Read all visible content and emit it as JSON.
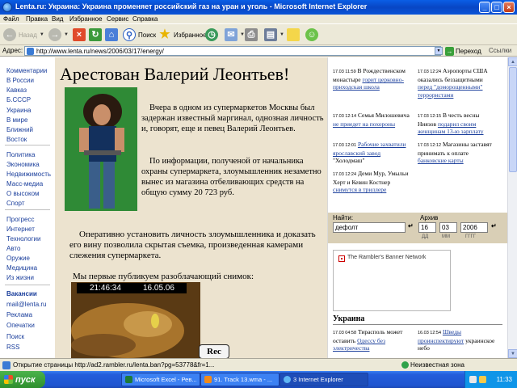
{
  "window": {
    "title": "Lenta.ru: Украина: Украина променяет российский газ на уран и уголь - Microsoft Internet Explorer",
    "min": "_",
    "max": "□",
    "close": "×"
  },
  "menu": [
    "Файл",
    "Правка",
    "Вид",
    "Избранное",
    "Сервис",
    "Справка"
  ],
  "toolbar": {
    "back": "Назад",
    "search": "Поиск",
    "favorites": "Избранное"
  },
  "addressbar": {
    "label": "Адрес:",
    "url": "http://www.lenta.ru/news/2006/03/17/energy/",
    "go": "Переход",
    "links": "Ссылки"
  },
  "leftnav": [
    "Комментарии",
    "В России",
    "Кавказ",
    "Б.СССР",
    "Украина",
    "В мире",
    "Ближний",
    "Восток",
    "Политика",
    "Экономика",
    "Недвижимость",
    "Масс-медиа",
    "О высоком",
    "Спорт",
    "Прогресс",
    "Интернет",
    "Технологии",
    "Авто",
    "Оружие",
    "Медицина",
    "Из жизни",
    "Вакансии",
    "mail@lenta.ru",
    "Реклама",
    "Опечатки",
    "Поиск",
    "RSS"
  ],
  "article": {
    "title": "Арестован Валерий Леонтьев!",
    "p1": "Вчера в одном из супермаркетов Москвы был задержан известный маргинал, однозная личность и, говорят, еще и певец Валерий Леонтьев.",
    "p2": "По информации, полученой от начальника охраны супермаркета, злоумышленник незаметно вынес из магазина отбеливающих средств на общую сумму 20 723 руб.",
    "p3": "Оперативно установить личность злоумышленника и доказать его вину позволила скрытая съемка, произведенная камерами слежения супермаркета.",
    "p4": "Мы первые публикуем разоблачающий снимок:",
    "cam_time": "21:46:34",
    "cam_date": "16.05.06",
    "rec": "Rec"
  },
  "sidebar": {
    "news_left": [
      {
        "time": "17.03 11:59",
        "pre": "В Рождественском монастыре",
        "link": "горит церковно-приходская школа",
        "post": ""
      },
      {
        "time": "17.03 12:14",
        "pre": "Семья Милошевича",
        "link": "не приедет на похороны",
        "post": ""
      },
      {
        "time": "17.03 12:01",
        "pre": "",
        "link": "Рабочие захватили ярославский завод",
        "post": "\"Холодмаш\""
      },
      {
        "time": "17.03 12:24",
        "pre": "Деми Мур, Умыльи Херт и Кевин Костнер",
        "link": "снимутся в триллере",
        "post": ""
      }
    ],
    "news_right": [
      {
        "time": "17.03 12:24",
        "pre": "Аэропорты США оказались беззащитными",
        "link": "перед \"доморощенными\" террористами",
        "post": ""
      },
      {
        "time": "17.03 12:15",
        "pre": "В честь весны Ниязов",
        "link": "подарил своим женщинам 13-ю зарплату",
        "post": ""
      },
      {
        "time": "17.03 12:12",
        "pre": "Магазины заставят принимать к оплате",
        "link": "банковские карты",
        "post": ""
      }
    ],
    "search": {
      "label": "Найти:",
      "value": "дефолт",
      "go": "↵"
    },
    "archive": {
      "label": "Архив",
      "day": "16",
      "month": "03",
      "year": "2006",
      "day_lbl": "ДД",
      "month_lbl": "ММ",
      "year_lbl": "ГГГГ",
      "go": "↵"
    },
    "banner": "The Rambler's Banner Network",
    "ukraine": {
      "heading": "Украина",
      "left": {
        "time": "17.03 04:58",
        "pre": "Тирасполь может оставить",
        "link": "Одессу без электричества",
        "post": ""
      },
      "right": {
        "time": "16.03 12:54",
        "pre": "",
        "link": "Шведы проинспектируют",
        "post": "украинское небо"
      }
    }
  },
  "statusbar": {
    "text": "Открытие страницы http://ad2.rambler.ru/lenta.ban?pg=53778&fr=1...",
    "zone": "Неизвестная зона"
  },
  "taskbar": {
    "start": "пуск",
    "tasks": [
      "Microsoft Excel - Рев...",
      "91. Track 13.wma - ...",
      "3 Internet Explorer"
    ],
    "clock": "11:33"
  }
}
